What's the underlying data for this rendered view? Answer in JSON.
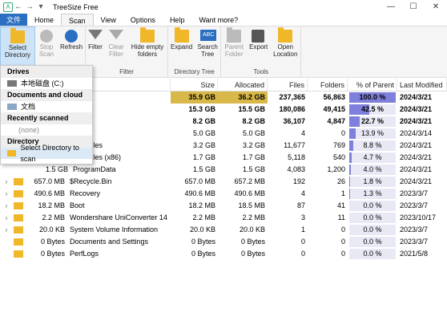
{
  "titlebar": {
    "title": "TreeSize Free",
    "minimize": "—",
    "maximize": "☐",
    "close": "✕"
  },
  "menu": {
    "file": "文件",
    "tabs": [
      "Home",
      "Scan",
      "View",
      "Options",
      "Help",
      "Want more?"
    ]
  },
  "ribbon": {
    "select_directory": "Select Directory",
    "stop_scan": "Stop Scan",
    "refresh": "Refresh",
    "filter": "Filter",
    "clear_filter": "Clear Filter",
    "hide_empty_folders": "Hide empty folders",
    "filter_group": "Filter",
    "expand": "Expand",
    "search_tree": "Search Tree",
    "directory_tree_group": "Directory Tree",
    "parent_folder": "Parent Folder",
    "export": "Export",
    "open_location": "Open Location",
    "tools_group": "Tools"
  },
  "dropdown": {
    "drives_header": "Drives",
    "drive_item": "本地磁盘 (C:)",
    "docs_header": "Documents and cloud",
    "docs_item": "文档",
    "recent_header": "Recently scanned",
    "recent_item": "(none)",
    "directory_header": "Directory",
    "directory_item": "Select Directory to scan"
  },
  "columns": {
    "size": "Size",
    "allocated": "Allocated",
    "files": "Files",
    "folders": "Folders",
    "percent": "% of Parent (...)",
    "modified": "Last Modified"
  },
  "rows": [
    {
      "expander": "",
      "name": "",
      "size": "35.9 GB",
      "allocated": "36.2 GB",
      "files": "237,365",
      "folders": "56,863",
      "percent": "100.0 %",
      "percent_value": 100.0,
      "modified": "2024/3/21"
    },
    {
      "expander": "",
      "name": "ws",
      "size": "15.3 GB",
      "allocated": "15.5 GB",
      "files": "180,086",
      "folders": "49,415",
      "percent": "42.5 %",
      "percent_value": 42.5,
      "modified": "2024/3/21"
    },
    {
      "expander": "",
      "name": "",
      "size": "8.2 GB",
      "allocated": "8.2 GB",
      "files": "36,107",
      "folders": "4,847",
      "percent": "22.7 %",
      "percent_value": 22.7,
      "modified": "2024/3/21"
    },
    {
      "expander": "",
      "name": "s]",
      "size": "5.0 GB",
      "allocated": "5.0 GB",
      "files": "4",
      "folders": "0",
      "percent": "13.9 %",
      "percent_value": 13.9,
      "modified": "2024/3/14"
    },
    {
      "expander": "",
      "name": "ram Files",
      "size": "3.2 GB",
      "allocated": "3.2 GB",
      "files": "11,677",
      "folders": "769",
      "percent": "8.8 %",
      "percent_value": 8.8,
      "modified": "2024/3/21"
    },
    {
      "expander": "",
      "name": "ram Files (x86)",
      "size": "1.7 GB",
      "allocated": "1.7 GB",
      "files": "5,118",
      "folders": "540",
      "percent": "4.7 %",
      "percent_value": 4.7,
      "modified": "2024/3/21"
    },
    {
      "expander": "",
      "name": "ProgramData",
      "size_prefix": "1.5 GB",
      "size": "1.5 GB",
      "allocated": "1.5 GB",
      "files": "4,083",
      "folders": "1,200",
      "percent": "4.0 %",
      "percent_value": 4.0,
      "modified": "2024/3/21"
    },
    {
      "expander": "›",
      "name_size": "657.0 MB",
      "name": "$Recycle.Bin",
      "size": "657.0 MB",
      "allocated": "657.2 MB",
      "files": "192",
      "folders": "26",
      "percent": "1.8 %",
      "percent_value": 1.8,
      "modified": "2024/3/21"
    },
    {
      "expander": "›",
      "name_size": "490.6 MB",
      "name": "Recovery",
      "size": "490.6 MB",
      "allocated": "490.6 MB",
      "files": "4",
      "folders": "1",
      "percent": "1.3 %",
      "percent_value": 1.3,
      "modified": "2023/3/7"
    },
    {
      "expander": "›",
      "name_size": "18.2 MB",
      "name": "Boot",
      "size": "18.2 MB",
      "allocated": "18.5 MB",
      "files": "87",
      "folders": "41",
      "percent": "0.0 %",
      "percent_value": 0.0,
      "modified": "2023/3/7"
    },
    {
      "expander": "›",
      "name_size": "2.2 MB",
      "name": "Wondershare UniConverter 14",
      "size": "2.2 MB",
      "allocated": "2.2 MB",
      "files": "3",
      "folders": "11",
      "percent": "0.0 %",
      "percent_value": 0.0,
      "modified": "2023/10/17"
    },
    {
      "expander": "›",
      "name_size": "20.0 KB",
      "name": "System Volume Information",
      "size": "20.0 KB",
      "allocated": "20.0 KB",
      "files": "1",
      "folders": "0",
      "percent": "0.0 %",
      "percent_value": 0.0,
      "modified": "2023/3/7"
    },
    {
      "expander": "",
      "name_size": "0 Bytes",
      "name": "Documents and Settings",
      "size": "0 Bytes",
      "allocated": "0 Bytes",
      "files": "0",
      "folders": "0",
      "percent": "0.0 %",
      "percent_value": 0.0,
      "modified": "2023/3/7"
    },
    {
      "expander": "",
      "name_size": "0 Bytes",
      "name": "PerfLogs",
      "size": "0 Bytes",
      "allocated": "0 Bytes",
      "files": "0",
      "folders": "0",
      "percent": "0.0 %",
      "percent_value": 0.0,
      "modified": "2021/5/8"
    }
  ]
}
